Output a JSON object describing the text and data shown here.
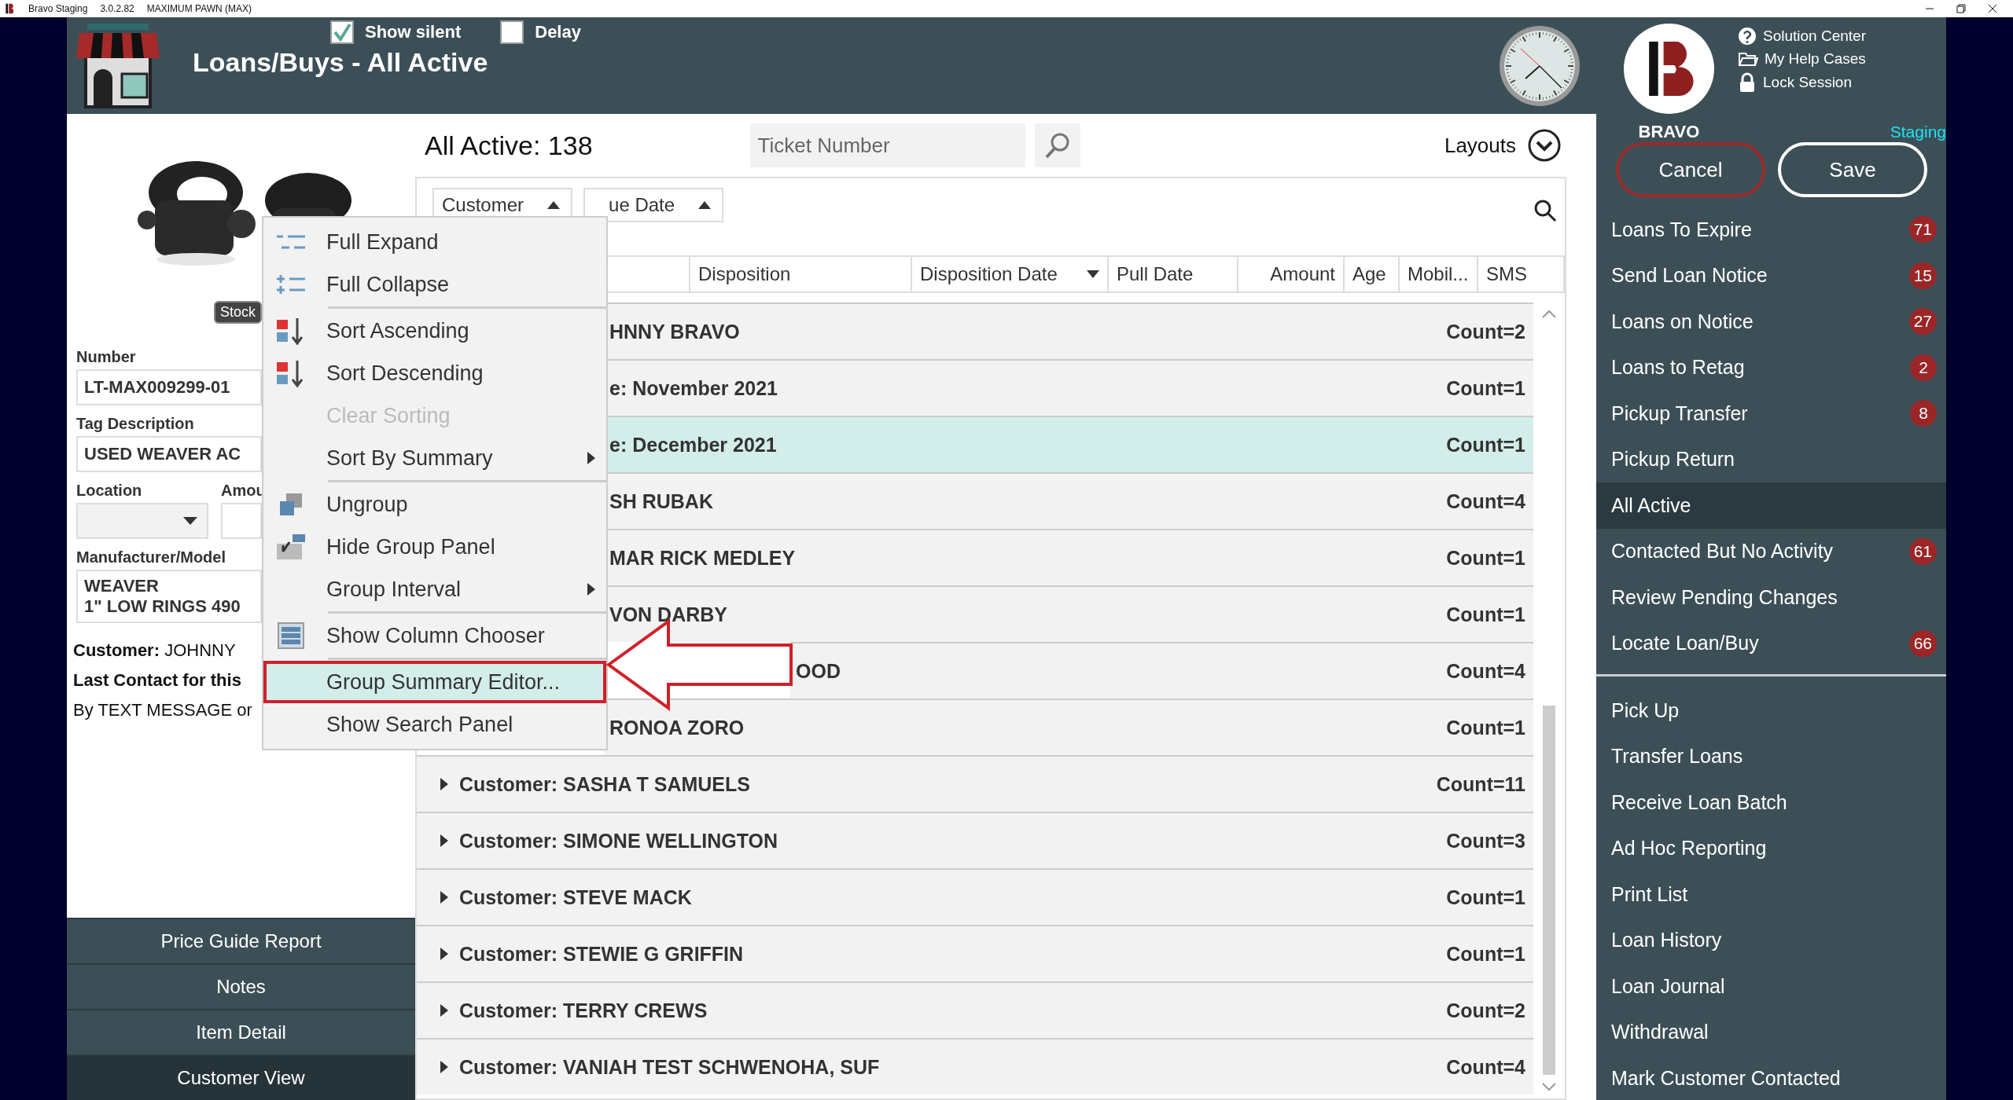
{
  "title_bar": {
    "app": "Bravo Staging",
    "version": "3.0.2.82",
    "store": "MAXIMUM PAWN (MAX)"
  },
  "header": {
    "title": "Loans/Buys - All Active",
    "options": [
      {
        "label": "Show silent",
        "checked": true
      },
      {
        "label": "Delay",
        "checked": false
      }
    ]
  },
  "left_panel": {
    "stock_badge": "Stock",
    "number": {
      "label": "Number",
      "value": "LT-MAX009299-01"
    },
    "tag_description": {
      "label": "Tag Description",
      "value": "USED WEAVER AC"
    },
    "location": {
      "label": "Location"
    },
    "amount": {
      "label": "Amou"
    },
    "manufacturer_model": {
      "label": "Manufacturer/Model",
      "lines": [
        "WEAVER",
        "1\" LOW RINGS 490"
      ]
    },
    "info_lines": [
      {
        "text": "**Customer:** JOHNNY",
        "bold": false
      },
      {
        "text": "Last Contact for this",
        "bold": true
      },
      {
        "text": "By TEXT MESSAGE or",
        "bold": false
      }
    ],
    "buttons": [
      {
        "label": "Price Guide Report",
        "selected": false
      },
      {
        "label": "Notes",
        "selected": false
      },
      {
        "label": "Item Detail",
        "selected": false
      },
      {
        "label": "Customer View",
        "selected": true
      }
    ]
  },
  "grid": {
    "count_label": "All Active: 138",
    "ticket_search": {
      "placeholder": "Ticket Number"
    },
    "layouts": "Layouts",
    "group_chips": [
      {
        "label": "Customer",
        "covered": false
      },
      {
        "label": "ue Date",
        "covered": true
      }
    ],
    "columns": [
      {
        "label": "Disposition",
        "sorted": false
      },
      {
        "label": "Disposition Date",
        "sorted": true
      },
      {
        "label": "Pull Date",
        "sorted": false
      },
      {
        "label": "Amount",
        "sorted": false
      },
      {
        "label": "Age",
        "sorted": false
      },
      {
        "label": "Mobil...",
        "sorted": false
      },
      {
        "label": "SMS",
        "sorted": false
      }
    ],
    "rows": [
      {
        "label": "HNNY BRAVO",
        "count": "Count=2",
        "kind": "covered",
        "selected": false
      },
      {
        "label": "e: November 2021",
        "count": "Count=1",
        "kind": "covered",
        "selected": false
      },
      {
        "label": "e: December 2021",
        "count": "Count=1",
        "kind": "covered",
        "selected": true
      },
      {
        "label": "SH RUBAK",
        "count": "Count=4",
        "kind": "covered",
        "selected": false
      },
      {
        "label": "MAR RICK MEDLEY",
        "count": "Count=1",
        "kind": "covered",
        "selected": false
      },
      {
        "label": "VON DARBY",
        "count": "Count=1",
        "kind": "covered",
        "selected": false
      },
      {
        "label": "OOD",
        "count": "Count=4",
        "kind": "pointer",
        "selected": false
      },
      {
        "label": "RONOA ZORO",
        "count": "Count=1",
        "kind": "covered",
        "selected": false
      },
      {
        "label": "Customer: SASHA T SAMUELS",
        "count": "Count=11",
        "kind": "group",
        "selected": false
      },
      {
        "label": "Customer: SIMONE WELLINGTON",
        "count": "Count=3",
        "kind": "group",
        "selected": false
      },
      {
        "label": "Customer: STEVE MACK",
        "count": "Count=1",
        "kind": "group",
        "selected": false
      },
      {
        "label": "Customer: STEWIE G GRIFFIN",
        "count": "Count=1",
        "kind": "group",
        "selected": false
      },
      {
        "label": "Customer: TERRY CREWS",
        "count": "Count=2",
        "kind": "group",
        "selected": false
      },
      {
        "label": "Customer: VANIAH TEST SCHWENOHA, SUF",
        "count": "Count=4",
        "kind": "group",
        "selected": false
      }
    ]
  },
  "context_menu": {
    "items": [
      {
        "label": "Full Expand",
        "disabled": false,
        "selected": false,
        "submenu": false,
        "divider_before": false
      },
      {
        "label": "Full Collapse",
        "disabled": false,
        "selected": false,
        "submenu": false,
        "divider_before": false
      },
      {
        "label": "Sort Ascending",
        "disabled": false,
        "selected": false,
        "submenu": false,
        "divider_before": true
      },
      {
        "label": "Sort Descending",
        "disabled": false,
        "selected": false,
        "submenu": false,
        "divider_before": false
      },
      {
        "label": "Clear Sorting",
        "disabled": true,
        "selected": false,
        "submenu": false,
        "divider_before": false
      },
      {
        "label": "Sort By Summary",
        "disabled": false,
        "selected": false,
        "submenu": true,
        "divider_before": false
      },
      {
        "label": "Ungroup",
        "disabled": false,
        "selected": false,
        "submenu": false,
        "divider_before": true
      },
      {
        "label": "Hide Group Panel",
        "disabled": false,
        "selected": false,
        "submenu": false,
        "divider_before": false
      },
      {
        "label": "Group Interval",
        "disabled": false,
        "selected": false,
        "submenu": true,
        "divider_before": false
      },
      {
        "label": "Show Column Chooser",
        "disabled": false,
        "selected": false,
        "submenu": false,
        "divider_before": true
      },
      {
        "label": "Group Summary Editor...",
        "disabled": false,
        "selected": true,
        "submenu": false,
        "divider_before": true
      },
      {
        "label": "Show Search Panel",
        "disabled": false,
        "selected": false,
        "submenu": false,
        "divider_before": false
      }
    ]
  },
  "sidebar": {
    "brand": "BRAVO",
    "help_links": [
      {
        "label": "Solution Center"
      },
      {
        "label": "My Help Cases"
      },
      {
        "label": "Lock Session"
      }
    ],
    "environment": "Staging",
    "actions": [
      {
        "label": "Cancel",
        "kind": "cancel"
      },
      {
        "label": "Save",
        "kind": "save"
      }
    ],
    "groups": [
      {
        "items": [
          {
            "label": "Loans To Expire",
            "badge": "71",
            "selected": false
          },
          {
            "label": "Send Loan Notice",
            "badge": "15",
            "selected": false
          },
          {
            "label": "Loans on Notice",
            "badge": "27",
            "selected": false
          },
          {
            "label": "Loans to Retag",
            "badge": "2",
            "selected": false
          },
          {
            "label": "Pickup Transfer",
            "badge": "8",
            "selected": false
          },
          {
            "label": "Pickup Return",
            "selected": false
          },
          {
            "label": "All Active",
            "selected": true
          },
          {
            "label": "Contacted But No Activity",
            "badge": "61",
            "selected": false
          },
          {
            "label": "Review Pending Changes",
            "selected": false
          },
          {
            "label": "Locate Loan/Buy",
            "badge": "66",
            "selected": false
          }
        ]
      },
      {
        "items": [
          {
            "label": "Pick Up",
            "selected": false
          },
          {
            "label": "Transfer Loans",
            "selected": false
          },
          {
            "label": "Receive Loan Batch",
            "selected": false
          },
          {
            "label": "Ad Hoc Reporting",
            "selected": false
          },
          {
            "label": "Print List",
            "selected": false
          },
          {
            "label": "Loan History",
            "selected": false
          },
          {
            "label": "Loan Journal",
            "selected": false
          },
          {
            "label": "Withdrawal",
            "selected": false
          },
          {
            "label": "Mark Customer Contacted",
            "selected": false
          }
        ]
      }
    ]
  }
}
